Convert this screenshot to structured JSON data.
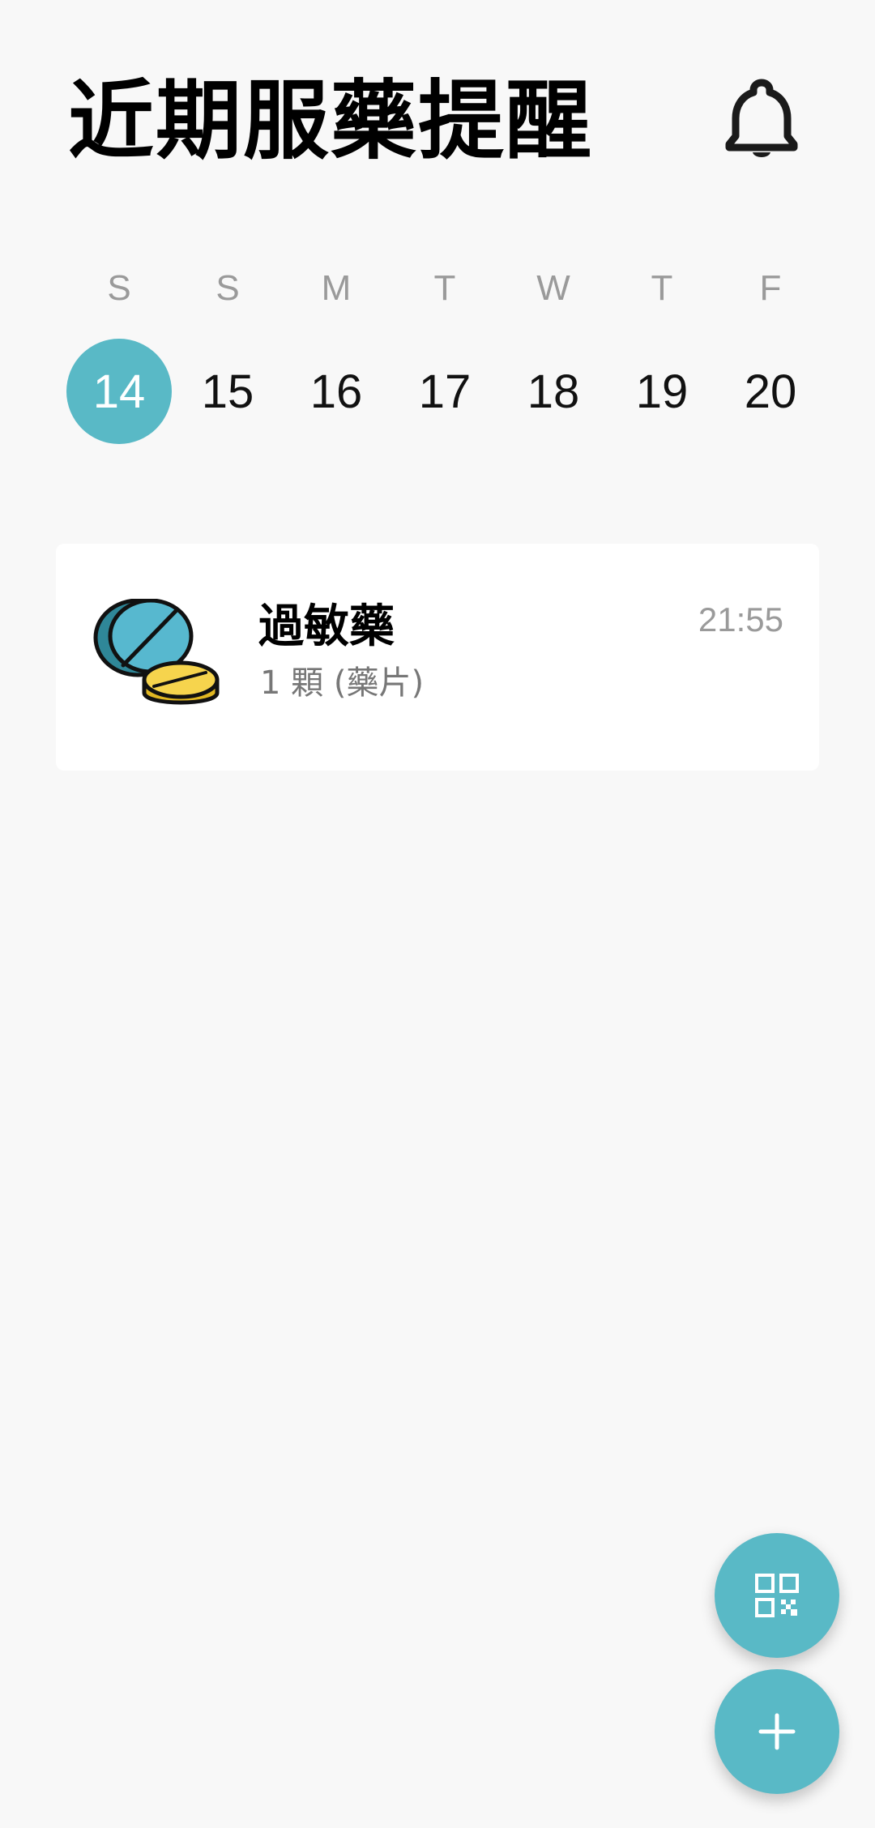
{
  "header": {
    "title": "近期服藥提醒",
    "bell_icon": "bell-icon"
  },
  "calendar": {
    "weekdays": [
      "S",
      "S",
      "M",
      "T",
      "W",
      "T",
      "F"
    ],
    "dates": [
      "14",
      "15",
      "16",
      "17",
      "18",
      "19",
      "20"
    ],
    "selected_date": "14",
    "accent_color": "#59b9c6"
  },
  "reminders": [
    {
      "name": "過敏藥",
      "dose": "1 顆 (藥片)",
      "time": "21:55",
      "icon": "pills-icon"
    }
  ],
  "actions": {
    "scan_icon": "qr-code-icon",
    "add_icon": "plus-icon"
  }
}
